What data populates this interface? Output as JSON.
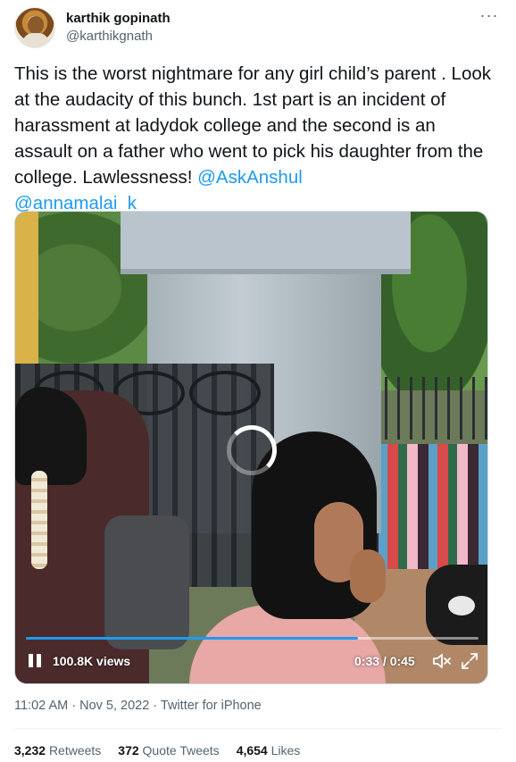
{
  "author": {
    "name": "karthik gopinath",
    "handle": "@karthikgnath",
    "avatar_icon": "avatar-photo"
  },
  "more_icon": "more-options-icon",
  "tweet": {
    "text": "This is the worst nightmare for any girl child’s parent . Look at the audacity of this bunch. 1st part is an incident of harassment at ladydok college and the second is an assault on a father who went to pick his daughter from the college. Lawlessness! ",
    "mentions": [
      "@AskAnshul",
      "@annamalai_k"
    ]
  },
  "video": {
    "views": "100.8K views",
    "time": "0:33 / 0:45",
    "progress": 0.733,
    "icons": [
      "pause-icon",
      "volume-icon",
      "fullscreen-icon",
      "loading-spinner"
    ]
  },
  "meta": {
    "time": "11:02 AM",
    "date": "Nov 5, 2022",
    "source": "Twitter for iPhone",
    "separator": " · "
  },
  "stats": {
    "retweets_count": "3,232",
    "retweets_label": "Retweets",
    "quotes_count": "372",
    "quotes_label": "Quote Tweets",
    "likes_count": "4,654",
    "likes_label": "Likes"
  },
  "colors": {
    "accent": "#1d9bf0",
    "text": "#0f1419",
    "secondary": "#536471"
  }
}
